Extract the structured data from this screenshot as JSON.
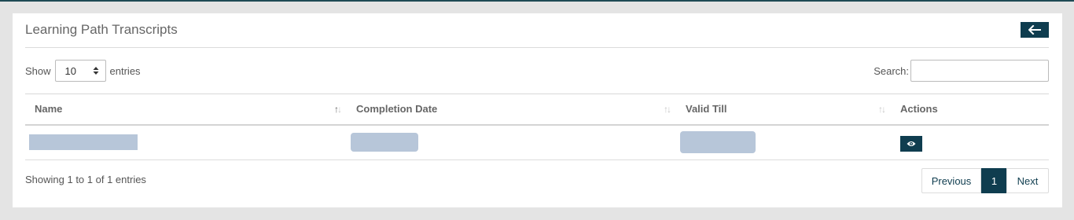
{
  "header": {
    "title": "Learning Path Transcripts",
    "back_icon": "arrow-left-icon"
  },
  "controls": {
    "show_label": "Show",
    "entries_value": "10",
    "entries_label": "entries",
    "search_label": "Search:",
    "search_value": ""
  },
  "table": {
    "columns": [
      {
        "label": "Name",
        "sortable": true,
        "sort": "asc"
      },
      {
        "label": "Completion Date",
        "sortable": true,
        "sort": "none"
      },
      {
        "label": "Valid Till",
        "sortable": true,
        "sort": "none"
      },
      {
        "label": "Actions",
        "sortable": false
      }
    ],
    "rows": [
      {
        "name": "[redacted]",
        "completion_date": "[redacted]",
        "valid_till": "[redacted]",
        "action_icon": "eye-icon"
      }
    ]
  },
  "footer": {
    "info": "Showing 1 to 1 of 1 entries",
    "pagination": {
      "previous": "Previous",
      "current_page": "1",
      "next": "Next"
    }
  },
  "colors": {
    "accent": "#0f3d4f",
    "redaction": "#b7c6d9",
    "page_background": "#e4e4e4"
  }
}
